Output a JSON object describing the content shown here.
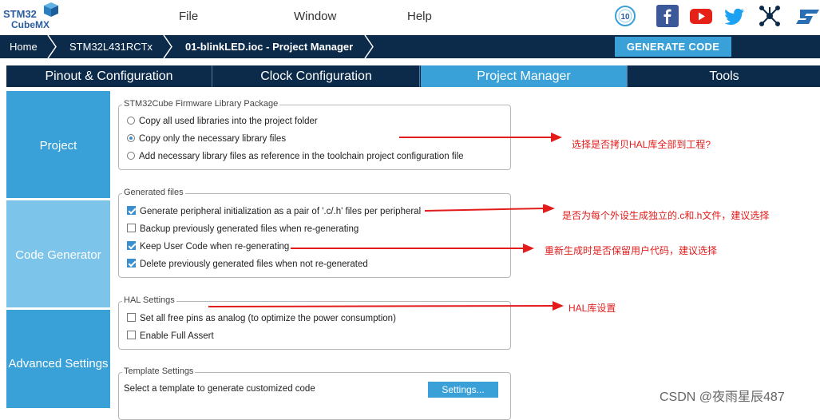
{
  "logo": {
    "line1": "STM32",
    "line2": "CubeMX"
  },
  "menu": {
    "file": "File",
    "window": "Window",
    "help": "Help"
  },
  "social": {
    "anniversary_label": "10",
    "icons": [
      "anniversary-badge-icon",
      "facebook-icon",
      "youtube-icon",
      "twitter-icon",
      "network-icon",
      "st-logo-icon"
    ]
  },
  "breadcrumb": {
    "home": "Home",
    "device": "STM32L431RCTx",
    "project": "01-blinkLED.ioc - Project Manager"
  },
  "generate_button": "GENERATE CODE",
  "tabs": [
    "Pinout & Configuration",
    "Clock Configuration",
    "Project Manager",
    "Tools"
  ],
  "active_tab": "Project Manager",
  "side_nav": {
    "project": "Project",
    "code_generator": "Code Generator",
    "advanced_settings": "Advanced Settings"
  },
  "firmware_group": {
    "legend": "STM32Cube Firmware Library Package",
    "options": [
      {
        "label": "Copy all used libraries into the project folder",
        "selected": false
      },
      {
        "label": "Copy only the necessary library files",
        "selected": true
      },
      {
        "label": "Add necessary library files as reference in the toolchain project configuration file",
        "selected": false
      }
    ]
  },
  "generated_files_group": {
    "legend": "Generated files",
    "options": [
      {
        "label": "Generate peripheral initialization as a pair of '.c/.h' files per peripheral",
        "checked": true
      },
      {
        "label": "Backup previously generated files when re-generating",
        "checked": false
      },
      {
        "label": "Keep User Code when re-generating",
        "checked": true
      },
      {
        "label": "Delete previously generated files when not re-generated",
        "checked": true
      }
    ]
  },
  "hal_group": {
    "legend": "HAL Settings",
    "options": [
      {
        "label": "Set all free pins as analog (to optimize the power consumption)",
        "checked": false
      },
      {
        "label": "Enable Full Assert",
        "checked": false
      }
    ]
  },
  "template_group": {
    "legend": "Template Settings",
    "description": "Select a template to generate customized code",
    "button": "Settings..."
  },
  "annotations": {
    "copy_hal": "选择是否拷贝HAL库全部到工程?",
    "separate_files": "是否为每个外设生成独立的.c和.h文件，建议选择",
    "keep_user_code": "重新生成时是否保留用户代码，建议选择",
    "hal_settings": "HAL库设置"
  },
  "watermark": "CSDN @夜雨星辰487",
  "colors": {
    "navy": "#0c2a4a",
    "accent_blue": "#3aa0d8",
    "side_dark": "#3aa0d8",
    "side_light": "#7cc4ea",
    "annotation_red": "#e41b1b"
  }
}
